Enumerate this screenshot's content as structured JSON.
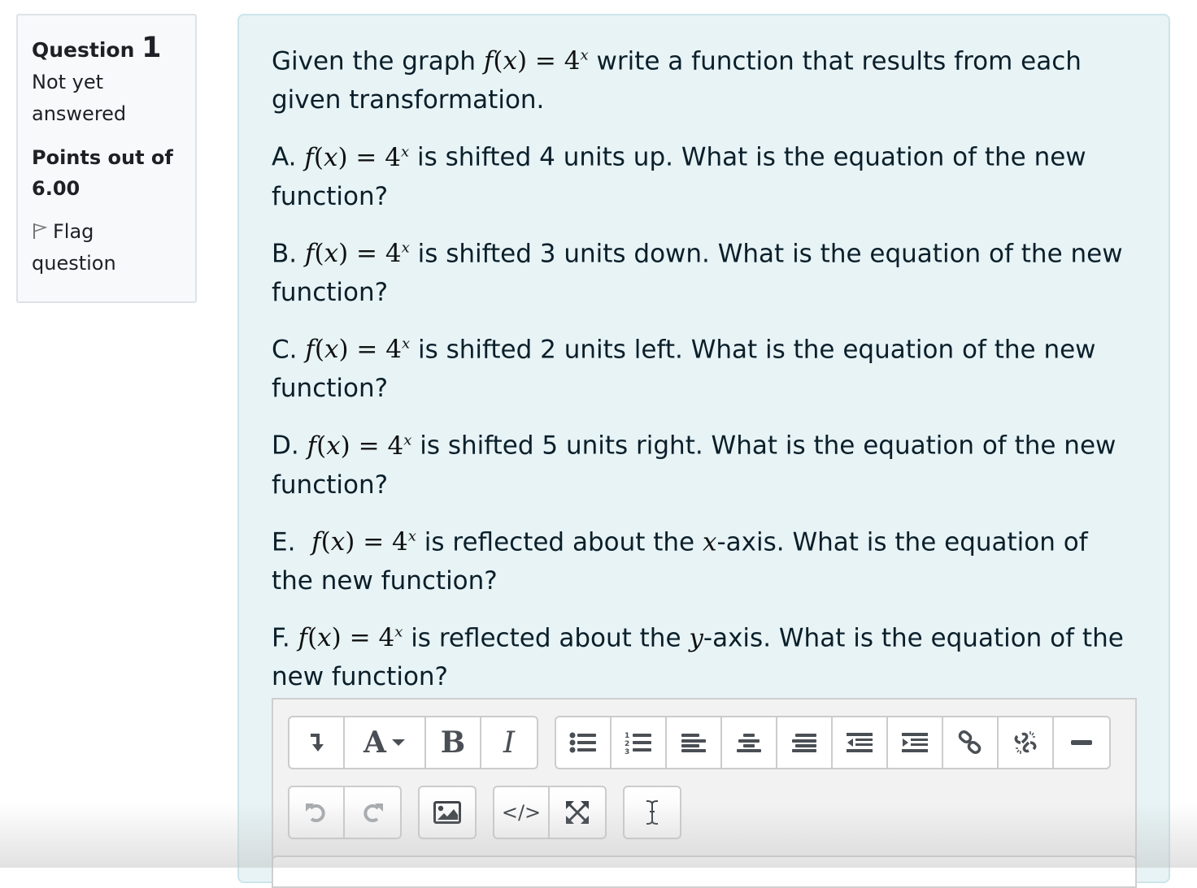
{
  "info": {
    "question_label": "Question",
    "question_number": "1",
    "state": "Not yet answered",
    "grade": "Points out of 6.00",
    "flag_label": "Flag question",
    "flag_icon": "flag-outline-icon"
  },
  "question": {
    "intro": {
      "before": "Given the graph ",
      "math": "f(x) = 4^x",
      "after": " write a function that results from each given transformation."
    },
    "parts": [
      {
        "label": "A.",
        "math": "f(x) = 4^x",
        "text": " is shifted 4 units up. What is the equation of the new function?"
      },
      {
        "label": "B.",
        "math": "f(x) = 4^x",
        "text": " is shifted 3 units down. What is the equation of the new function?"
      },
      {
        "label": "C.",
        "math": "f(x) = 4^x",
        "text": " is shifted 2 units left. What is the equation of the new function?"
      },
      {
        "label": "D.",
        "math": "f(x) = 4^x",
        "text": " is shifted 5 units right. What is the equation of the new function?"
      },
      {
        "label": "E.",
        "math": "f(x) = 4^x",
        "text_before": " is reflected about the ",
        "var": "x",
        "text_after": "-axis. What is the equation of the new function?"
      },
      {
        "label": "F.",
        "math": "f(x) = 4^x",
        "text_before": " is reflected about the ",
        "var": "y",
        "text_after": "-axis. What is the equation of the new function?"
      }
    ],
    "math_parts": {
      "f": "f",
      "x": "x",
      "eq": " = ",
      "base": "4",
      "exp": "x",
      "open": "(",
      "close": ")"
    }
  },
  "editor": {
    "toolbar_row1": [
      [
        "show-more-buttons-icon",
        "font-style-icon",
        "bold-icon",
        "italic-icon"
      ],
      [
        "unordered-list-icon",
        "ordered-list-icon",
        "align-left-icon",
        "align-center-icon",
        "align-right-icon",
        "outdent-icon",
        "indent-icon",
        "link-icon",
        "unlink-icon",
        "horizontal-rule-icon"
      ]
    ],
    "toolbar_row2": [
      [
        "undo-icon",
        "redo-icon"
      ],
      [
        "image-icon"
      ],
      [
        "html-source-icon",
        "fullscreen-icon"
      ],
      [
        "text-cursor-icon"
      ]
    ],
    "font_glyph": "A",
    "bold_glyph": "B",
    "italic_glyph": "I",
    "code_glyph": "</>",
    "cursor_glyph": "I"
  }
}
